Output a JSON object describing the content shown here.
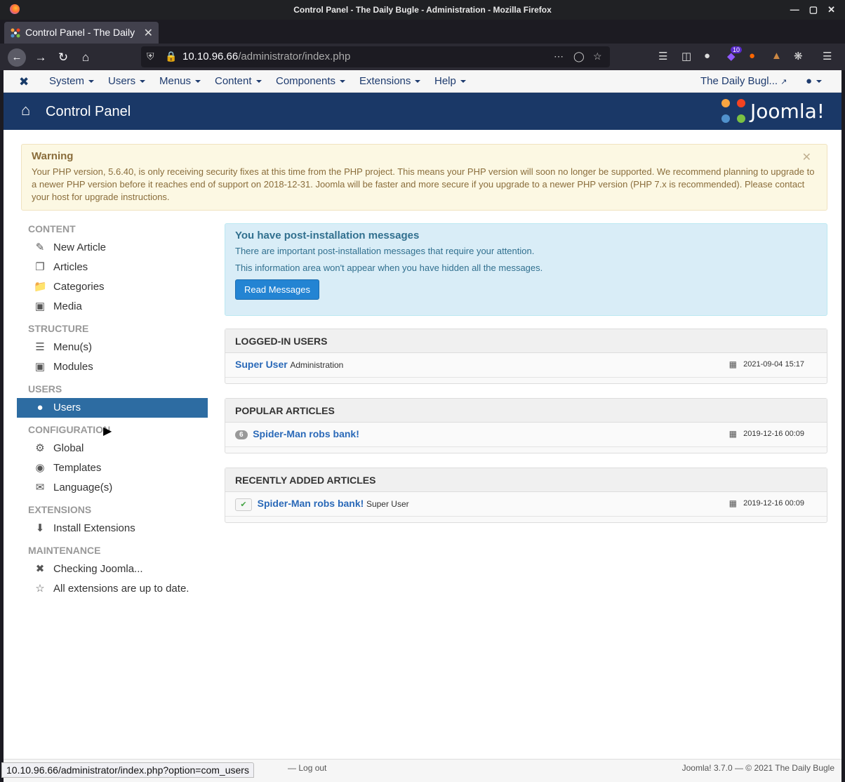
{
  "window": {
    "title": "Control Panel - The Daily Bugle - Administration - Mozilla Firefox"
  },
  "tab": {
    "label": "Control Panel - The Daily"
  },
  "url": {
    "host": "10.10.96.66",
    "path": "/administrator/index.php"
  },
  "toolbar": {
    "ext_badge": "10"
  },
  "topmenu": {
    "items": [
      "System",
      "Users",
      "Menus",
      "Content",
      "Components",
      "Extensions",
      "Help"
    ],
    "site_link": "The Daily Bugl..."
  },
  "header": {
    "page_title": "Control Panel",
    "brand": "Joomla!"
  },
  "warning": {
    "title": "Warning",
    "text": "Your PHP version, 5.6.40, is only receiving security fixes at this time from the PHP project. This means your PHP version will soon no longer be supported. We recommend planning to upgrade to a newer PHP version before it reaches end of support on 2018-12-31. Joomla will be faster and more secure if you upgrade to a newer PHP version (PHP 7.x is recommended). Please contact your host for upgrade instructions."
  },
  "sidebar": {
    "content_head": "CONTENT",
    "new_article": "New Article",
    "articles": "Articles",
    "categories": "Categories",
    "media": "Media",
    "structure_head": "STRUCTURE",
    "menus": "Menu(s)",
    "modules": "Modules",
    "users_head": "USERS",
    "users": "Users",
    "config_head": "CONFIGURATION",
    "global": "Global",
    "templates": "Templates",
    "languages": "Language(s)",
    "ext_head": "EXTENSIONS",
    "install_ext": "Install Extensions",
    "maint_head": "MAINTENANCE",
    "checking": "Checking Joomla...",
    "uptodate": "All extensions are up to date."
  },
  "postinstall": {
    "title": "You have post-installation messages",
    "line1": "There are important post-installation messages that require your attention.",
    "line2": "This information area won't appear when you have hidden all the messages.",
    "button": "Read Messages"
  },
  "logged_in": {
    "title": "LOGGED-IN USERS",
    "user": "Super User",
    "area": "Administration",
    "date": "2021-09-04 15:17"
  },
  "popular": {
    "title": "POPULAR ARTICLES",
    "hits": "6",
    "article": "Spider-Man robs bank!",
    "date": "2019-12-16 00:09"
  },
  "recent": {
    "title": "RECENTLY ADDED ARTICLES",
    "article": "Spider-Man robs bank!",
    "author": "Super User",
    "date": "2019-12-16 00:09"
  },
  "footer": {
    "logout": "Log out",
    "version": "Joomla! 3.7.0  —  © 2021 The Daily Bugle"
  },
  "status_url": "10.10.96.66/administrator/index.php?option=com_users"
}
